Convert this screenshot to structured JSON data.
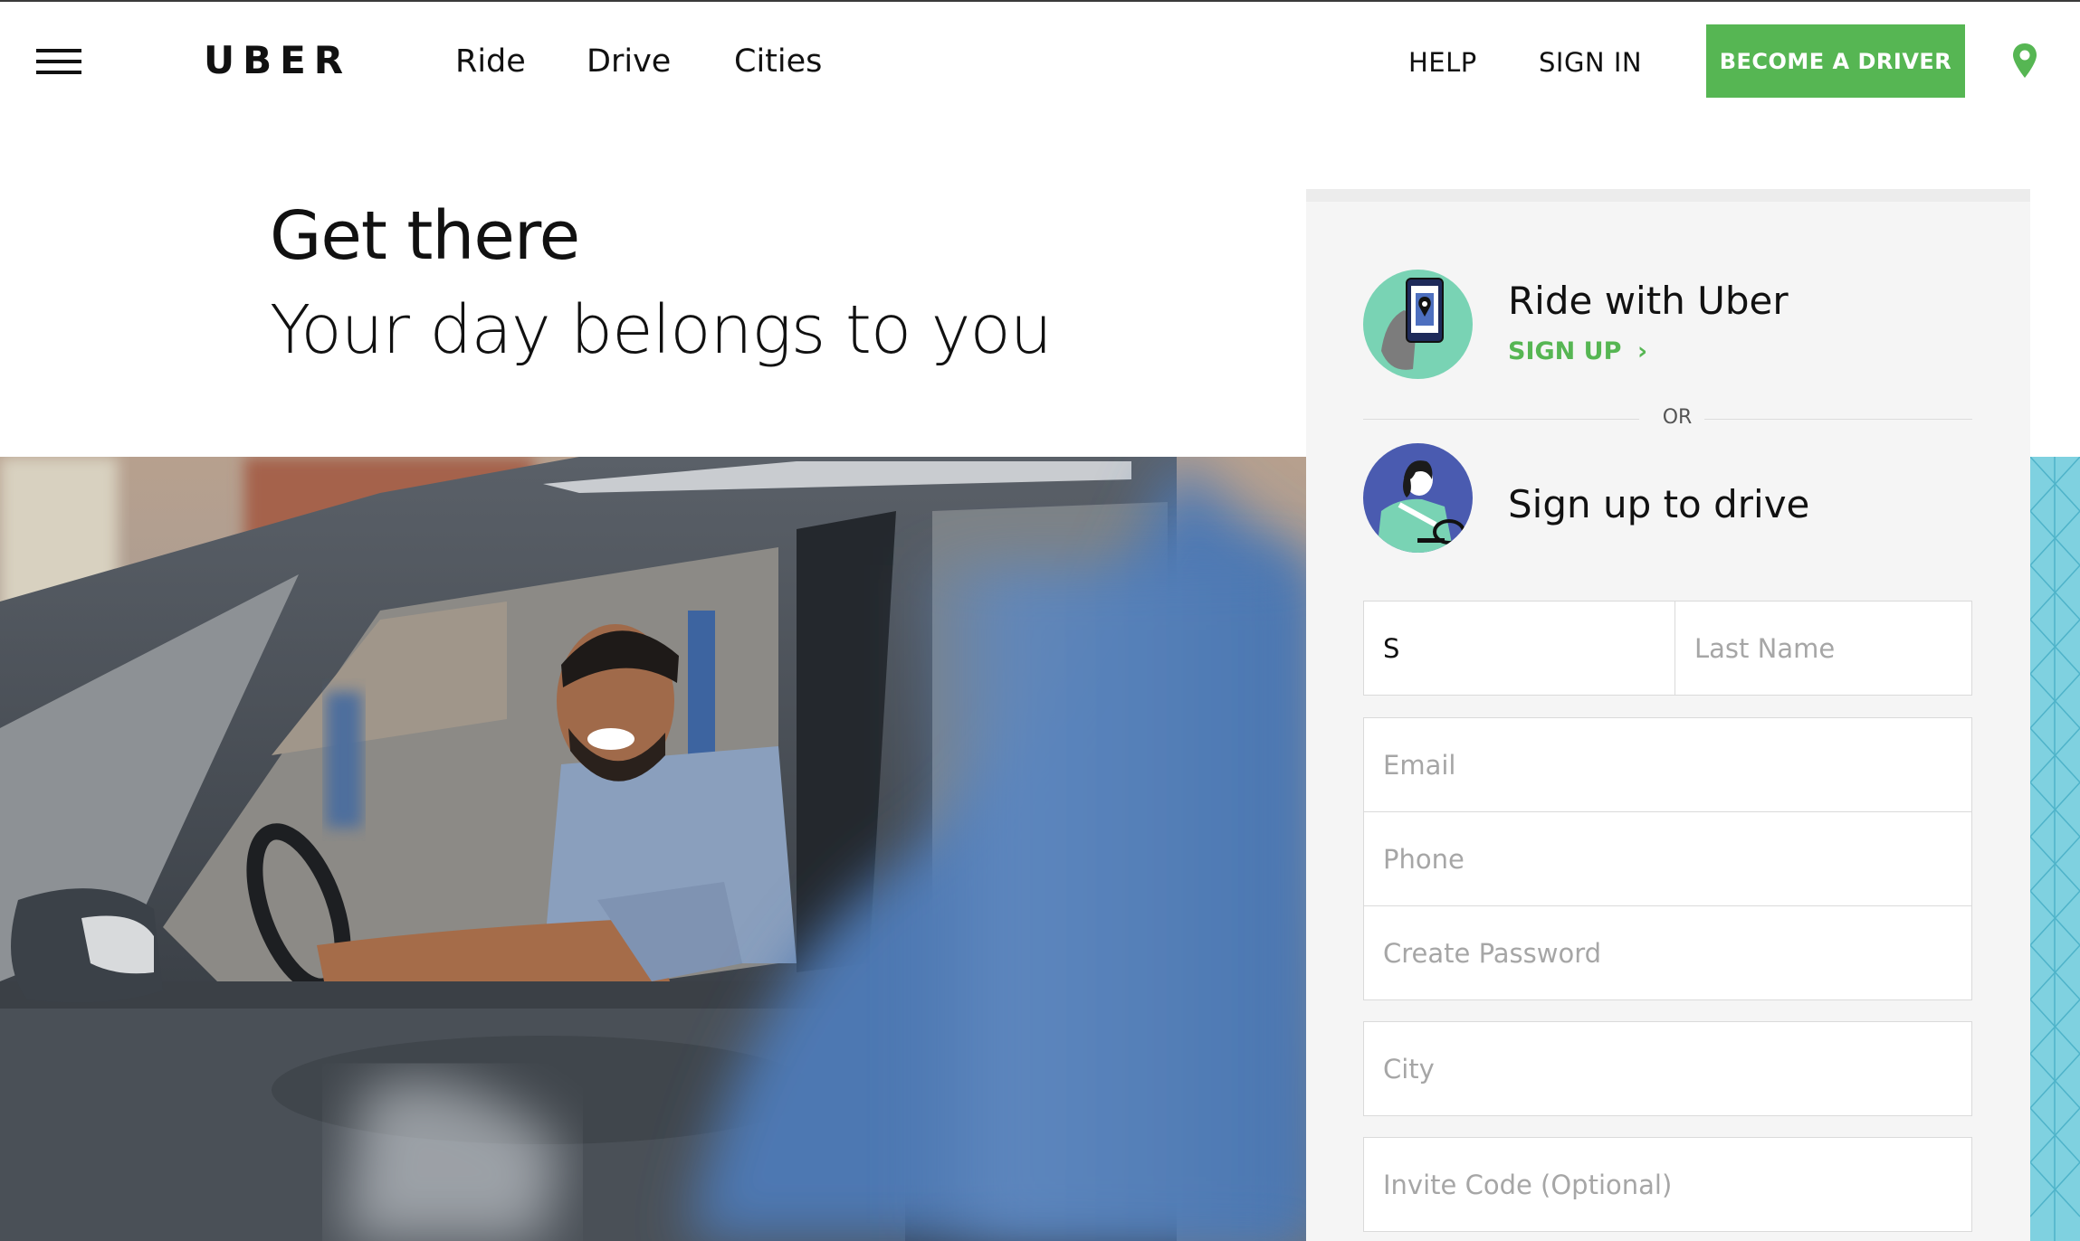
{
  "header": {
    "logo": "UBER",
    "nav": {
      "ride": "Ride",
      "drive": "Drive",
      "cities": "Cities"
    },
    "help": "HELP",
    "sign_in": "SIGN IN",
    "become_driver": "BECOME A DRIVER",
    "menu_icon": "hamburger-icon",
    "location_icon": "map-pin-icon",
    "accent_color": "#56b653"
  },
  "hero": {
    "headline": "Get there",
    "subheadline": "Your day belongs to you"
  },
  "panel": {
    "ride": {
      "title": "Ride with Uber",
      "signup": "SIGN UP",
      "chevron": "›"
    },
    "or": "OR",
    "drive": {
      "title": "Sign up to drive"
    },
    "form": {
      "first_name_value": "S",
      "last_name_placeholder": "Last Name",
      "email_placeholder": "Email",
      "phone_placeholder": "Phone",
      "password_placeholder": "Create Password",
      "city_placeholder": "City",
      "invite_placeholder": "Invite Code (Optional)"
    }
  }
}
